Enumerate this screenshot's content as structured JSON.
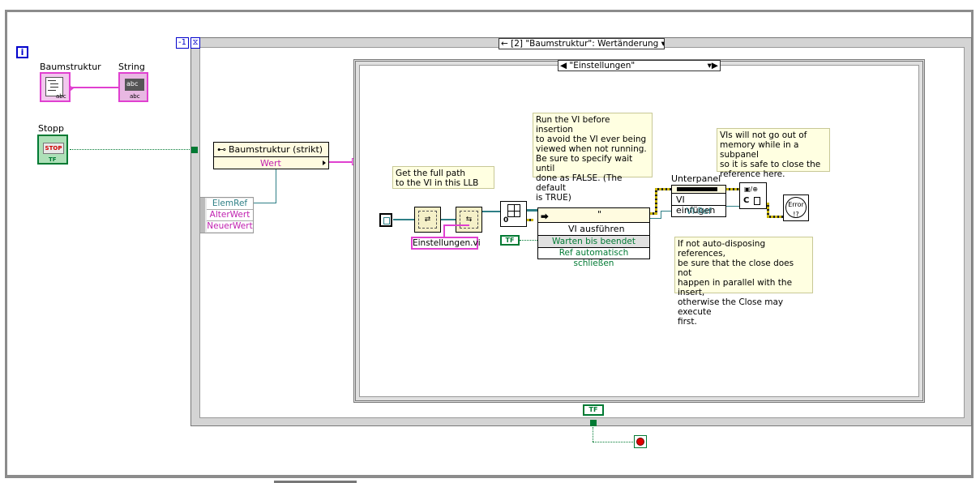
{
  "iteration_label": "i",
  "controls": {
    "tree": "Baumstruktur",
    "string": "String",
    "stop": "Stopp",
    "stop_text": "STOP",
    "tf_text": "TF",
    "abc_text": "abc"
  },
  "loop": {
    "timeout": "-1",
    "event_case": "[2] \"Baumstruktur\": Werländerung",
    "event_case_display": "← [2] \"Baumstruktur\": Wertänderung ▾▶"
  },
  "inner_case": {
    "selector": "◀ \"Einstellungen\"",
    "selector_arrows": "▾▶"
  },
  "property_node": {
    "title": "Baumstruktur (strikt)",
    "property": "Wert"
  },
  "event_data": {
    "items": [
      "ElemRef",
      "AlterWert",
      "NeuerWert"
    ]
  },
  "notes": {
    "path": "Get the full path\nto the VI in this LLB",
    "run": "Run the VI before insertion\nto avoid the VI ever being\nviewed when not running.\nBe sure to specify wait until\ndone as FALSE.  (The default\nis TRUE)",
    "memory": "VIs will not go out of\nmemory while in a subpanel\nso it is safe to close the\nreference here.",
    "dispose": "If not auto-disposing references,\nbe sure that the close does not\nhappen in parallel with the insert,\notherwise the Close may execute\nfirst."
  },
  "vi_name": "Einstellungen.vi",
  "invoke_run": {
    "title": "VI ausführen",
    "quote": "\"",
    "params": [
      "Warten bis beendet",
      "Ref automatisch schließen"
    ]
  },
  "subpanel": {
    "label": "Unterpanel",
    "method": "VI einfügen",
    "param": "VI-Ref"
  },
  "bool_const": "TF",
  "error_text": "Error",
  "close_text": "C",
  "colors": {
    "pink": "#e040d0",
    "green": "#007a33",
    "teal": "#2e7f86",
    "note_bg": "#ffffe1",
    "loop_gray": "#c0c0c0",
    "blue": "#0000cc"
  }
}
